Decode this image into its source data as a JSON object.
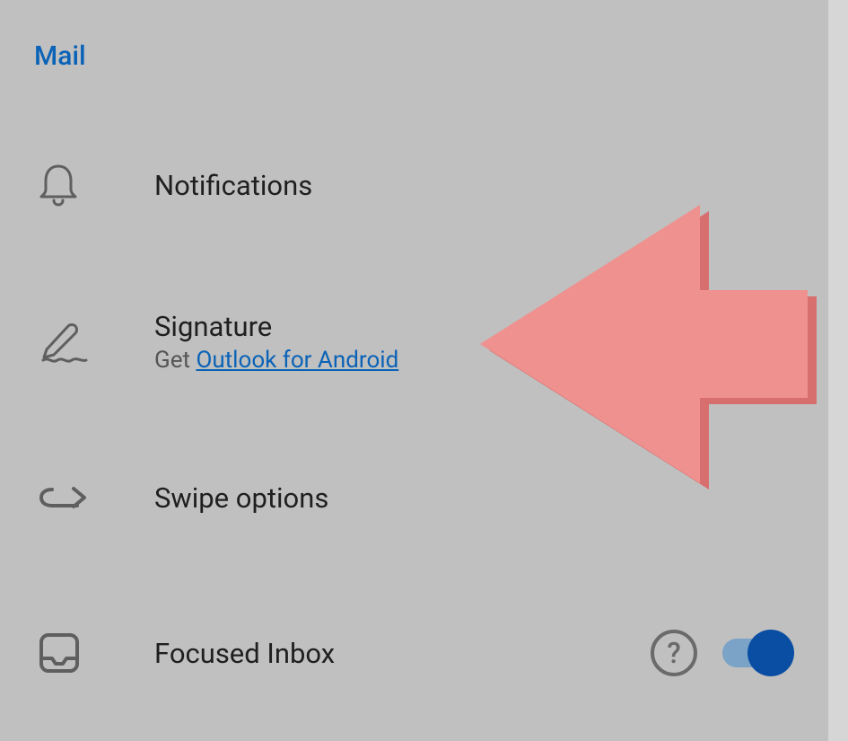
{
  "section_header": "Mail",
  "rows": {
    "notifications": {
      "title": "Notifications"
    },
    "signature": {
      "title": "Signature",
      "subtitle_prefix": "Get ",
      "subtitle_link": "Outlook for Android"
    },
    "swipe": {
      "title": "Swipe options"
    },
    "focused": {
      "title": "Focused Inbox"
    }
  },
  "help_icon_glyph": "?",
  "focused_toggle_on": true
}
